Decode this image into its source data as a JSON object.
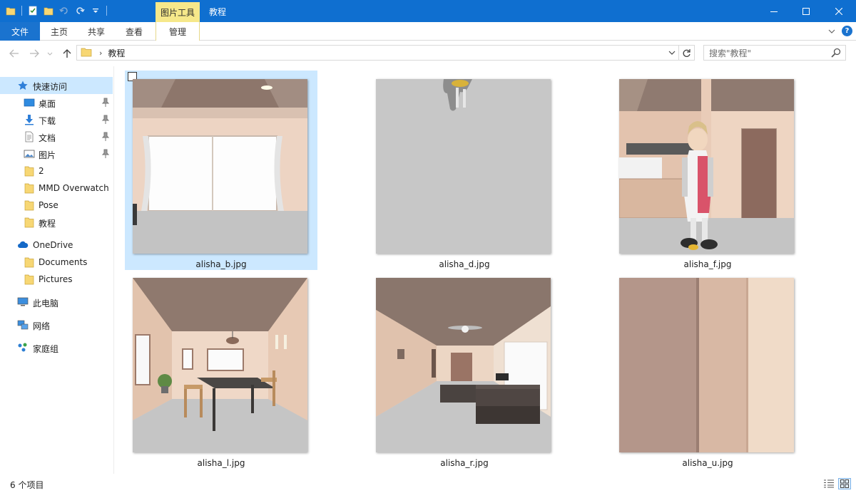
{
  "window": {
    "title": "教程",
    "contextual_tab_group": "图片工具",
    "accent_color": "#0f6fd0",
    "contextual_color": "#f6e88a"
  },
  "ribbon": {
    "file_tab": "文件",
    "tabs": [
      {
        "label": "主页"
      },
      {
        "label": "共享"
      },
      {
        "label": "查看"
      },
      {
        "label": "管理"
      }
    ],
    "help_label": "?"
  },
  "address": {
    "separator": "›",
    "crumb": "教程",
    "search_placeholder": "搜索\"教程\""
  },
  "sidebar": {
    "quick_access": "快速访问",
    "quick_items": [
      {
        "label": "桌面",
        "icon": "desktop-icon",
        "pinned": true
      },
      {
        "label": "下载",
        "icon": "download-icon",
        "pinned": true
      },
      {
        "label": "文档",
        "icon": "document-icon",
        "pinned": true
      },
      {
        "label": "图片",
        "icon": "pictures-icon",
        "pinned": true
      },
      {
        "label": "2",
        "icon": "folder-icon",
        "pinned": false
      },
      {
        "label": "MMD Overwatch",
        "icon": "folder-icon",
        "pinned": false
      },
      {
        "label": "Pose",
        "icon": "folder-icon",
        "pinned": false
      },
      {
        "label": "教程",
        "icon": "folder-icon",
        "pinned": false
      }
    ],
    "onedrive": "OneDrive",
    "onedrive_items": [
      {
        "label": "Documents",
        "icon": "folder-icon"
      },
      {
        "label": "Pictures",
        "icon": "folder-icon"
      }
    ],
    "this_pc": "此电脑",
    "network": "网络",
    "homegroup": "家庭组"
  },
  "files": [
    {
      "name": "alisha_b.jpg",
      "selected": true
    },
    {
      "name": "alisha_d.jpg",
      "selected": false
    },
    {
      "name": "alisha_f.jpg",
      "selected": false
    },
    {
      "name": "alisha_l.jpg",
      "selected": false
    },
    {
      "name": "alisha_r.jpg",
      "selected": false
    },
    {
      "name": "alisha_u.jpg",
      "selected": false
    }
  ],
  "status": {
    "item_count": "6 个项目"
  }
}
